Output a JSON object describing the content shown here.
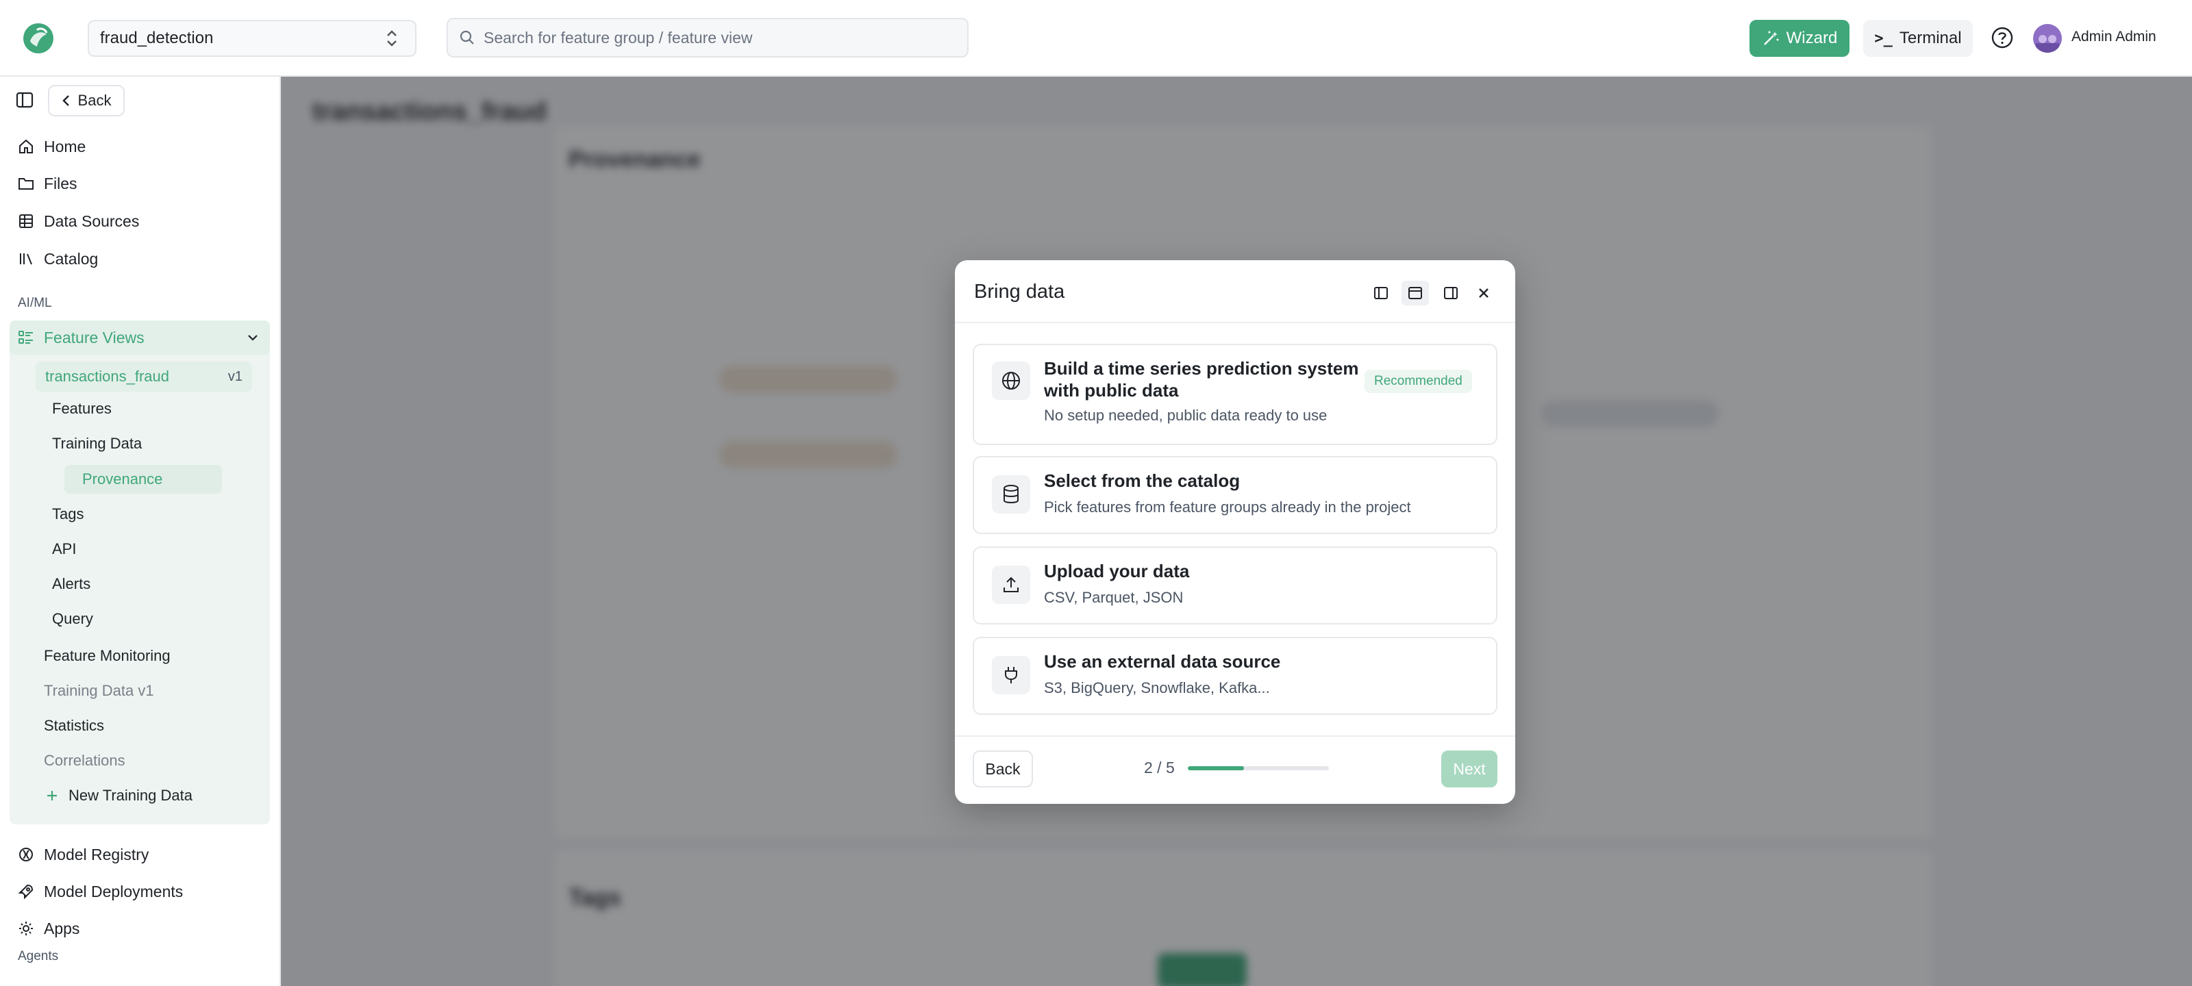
{
  "topbar": {
    "project": "fraud_detection",
    "search_placeholder": "Search for feature group / feature view",
    "wizard_label": "Wizard",
    "terminal_prompt": ">_",
    "terminal_label": "Terminal",
    "user_name": "Admin Admin"
  },
  "sidebar": {
    "back_label": "Back",
    "nav": [
      {
        "label": "Home",
        "icon": "home-icon"
      },
      {
        "label": "Files",
        "icon": "folder-icon"
      },
      {
        "label": "Data Sources",
        "icon": "table-icon"
      },
      {
        "label": "Catalog",
        "icon": "library-icon"
      }
    ],
    "section_aiml": "AI/ML",
    "feature_views_label": "Feature Views",
    "current_view": {
      "name": "transactions_fraud",
      "version": "v1"
    },
    "sub_items": [
      "Features",
      "Training Data",
      "Provenance",
      "Tags",
      "API",
      "Alerts",
      "Query"
    ],
    "active_sub_item": "Provenance",
    "children": [
      {
        "label": "Feature Monitoring",
        "muted": false
      },
      {
        "label": "Training Data v1",
        "muted": true
      },
      {
        "label": "Statistics",
        "muted": false
      },
      {
        "label": "Correlations",
        "muted": true
      }
    ],
    "new_training_data_label": "New Training Data",
    "bottom_nav": [
      {
        "label": "Model Registry",
        "icon": "model-registry-icon"
      },
      {
        "label": "Model Deployments",
        "icon": "rocket-icon"
      },
      {
        "label": "Apps",
        "icon": "apps-gear-icon"
      }
    ],
    "section_agents": "Agents"
  },
  "background": {
    "page_title": "transactions_fraud",
    "provenance_title": "Provenance",
    "tags_title": "Tags"
  },
  "modal": {
    "title": "Bring data",
    "options": [
      {
        "title": "Build a time series prediction system with public data",
        "desc": "No setup needed, public data ready to use",
        "badge": "Recommended",
        "icon": "globe-icon"
      },
      {
        "title": "Select from the catalog",
        "desc": "Pick features from feature groups already in the project",
        "icon": "database-icon"
      },
      {
        "title": "Upload your data",
        "desc": "CSV, Parquet, JSON",
        "icon": "upload-icon"
      },
      {
        "title": "Use an external data source",
        "desc": "S3, BigQuery, Snowflake, Kafka...",
        "icon": "plug-icon"
      }
    ],
    "back_label": "Back",
    "step_text": "2 / 5",
    "progress_fraction": 0.4,
    "next_label": "Next"
  },
  "colors": {
    "accent": "#3fa77a",
    "accent_light": "#eef4f1",
    "next_disabled": "#a9d8c1"
  }
}
